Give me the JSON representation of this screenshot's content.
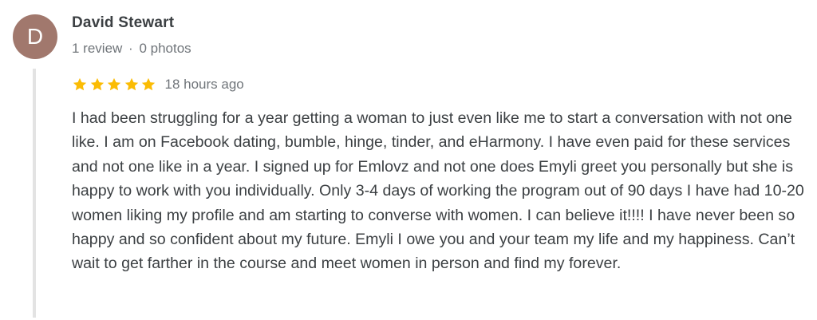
{
  "review": {
    "author": {
      "initial": "D",
      "avatar_color": "#a1786d",
      "name": "David Stewart",
      "review_count": "1 review",
      "separator": "·",
      "photo_count": "0 photos"
    },
    "rating": {
      "stars": 5,
      "max_stars": 5,
      "star_color": "#fbbc04",
      "time_ago": "18 hours ago"
    },
    "text": "I had been struggling for a year getting a woman to just even like me to start a conversation with not one like. I am on Facebook dating, bumble, hinge, tinder, and eHarmony. I have even paid for these services and not one like in a year. I signed up for Emlovz and not one does Emyli greet you personally but she is happy to work with you individually. Only 3-4 days of working the program out of 90 days I have had 10-20 women liking my profile and am starting to converse with women. I can believe it!!!! I have never been so happy and so confident about my future. Emyli I owe you and your team my life and my happiness. Can’t wait to get farther in the course and meet women in person and find my forever."
  }
}
